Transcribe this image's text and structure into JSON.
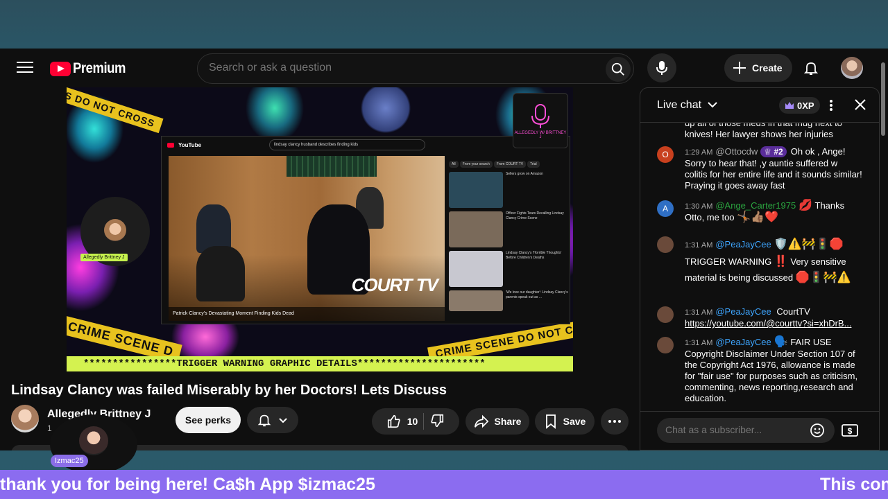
{
  "header": {
    "logo_text": "Premium",
    "search_placeholder": "Search or ask a question",
    "create_label": "Create"
  },
  "video": {
    "inner_search": "lindsay clancy husband describes finding kids",
    "inner_logo": "YouTube",
    "inner_caption": "Patrick Clancy's Devastating Moment Finding Kids Dead",
    "court_tv": "COURT TV",
    "cam_label": "Allegedly Brittney J",
    "podcast_label": "ALLEGEDLY W/ BRITTNEY J",
    "tape_top": "IS DO NOT CROSS",
    "tape_left": "CRIME SCENE D",
    "tape_right": "CRIME SCENE DO NOT CROSS",
    "warning_banner": "****************TRIGGER WARNING GRAPHIC DETAILS**********************",
    "inner_chips": [
      "All",
      "From your search",
      "From COURT TV",
      "Trial"
    ],
    "inner_side": [
      "Sellers grow on Amazon",
      "Officer Fights Tears Recalling Lindsay Clancy Crime Scene",
      "Lindsay Clancy's 'Horrible Thoughts' Before Children's Deaths",
      "'We love our daughter': Lindsay Clancy's parents speak out as ..."
    ]
  },
  "below": {
    "title": "Lindsay Clancy was failed Miserably by her Doctors! Lets Discuss",
    "channel_name": "Allegedly Brittney J",
    "channel_subs": "1",
    "perks_label": "See perks",
    "like_count": "10",
    "share_label": "Share",
    "save_label": "Save"
  },
  "chat": {
    "title": "Live chat",
    "xp": "0XP",
    "input_placeholder": "Chat as a subscriber...",
    "top_partial": "up all of those meds in that mug next to knives! Her lawyer shows her injuries",
    "messages": [
      {
        "avatar": "O",
        "color": "#c8401e",
        "time": "1:29 AM",
        "author": "@Ottocdw",
        "badge": "#2",
        "text": "Oh ok , Ange! Sorry to hear that! ,y auntie suffered w colitis for her entire life and it sounds similar! Praying it goes away fast"
      },
      {
        "avatar": "A",
        "color": "#2f6fc4",
        "time": "1:30 AM",
        "author": "@Ange_Carter1975",
        "text": "Thanks Otto, me too"
      },
      {
        "avatar": "",
        "color": "#6a4a3a",
        "time": "1:31 AM",
        "author": "@PeaJayCee",
        "text": "TRIGGER WARNING",
        "text2": "Very sensitive material is being discussed"
      },
      {
        "avatar": "",
        "color": "#6a4a3a",
        "time": "1:31 AM",
        "author": "@PeaJayCee",
        "text": "CourtTV",
        "link": "https://youtube.com/@courttv?si=xhDrB..."
      },
      {
        "avatar": "",
        "color": "#6a4a3a",
        "time": "1:31 AM",
        "author": "@PeaJayCee",
        "text": "FAIR USE Copyright Disclaimer Under Section 107 of the Copyright Act 1976, allowance is made for \"fair use\" for purposes such as criticism, commenting, news reporting,research and education."
      }
    ]
  },
  "overlay": {
    "bubble_label": "Izmac25",
    "ticker_left": "thank you for being here! Ca$h App $izmac25",
    "ticker_right": "This con"
  },
  "colors": {
    "accent_red": "#ff0033",
    "ticker_bg": "#8b6cf0",
    "warning_bg": "#d4f250",
    "link_blue": "#3ea6ff"
  }
}
